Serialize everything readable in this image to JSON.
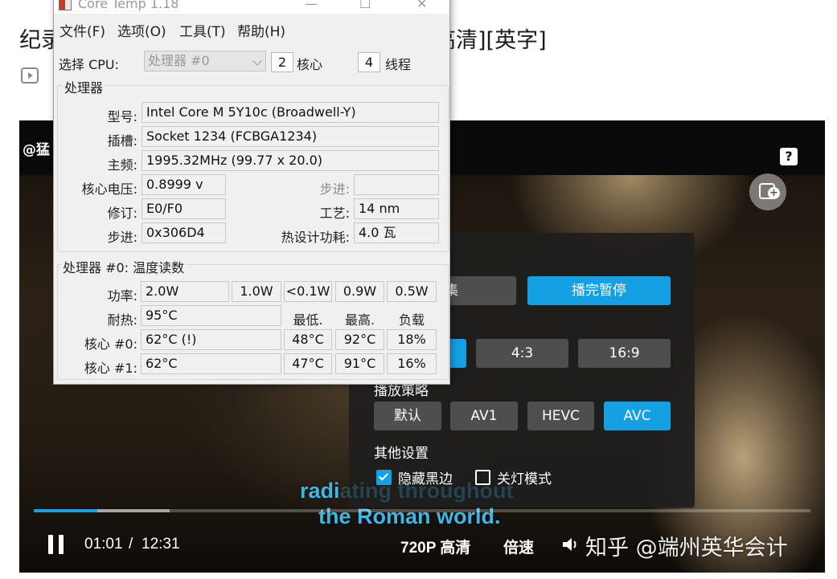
{
  "page": {
    "title_left": "纪录",
    "title_right": "高清][英字]"
  },
  "video": {
    "uploader": "@猛",
    "help_label": "?",
    "settings": {
      "row1": [
        {
          "label": "切集",
          "active": false
        },
        {
          "label": "播完暂停",
          "active": true
        }
      ],
      "row2": [
        {
          "label": "",
          "active": true
        },
        {
          "label": "4:3",
          "active": false
        },
        {
          "label": "16:9",
          "active": false
        }
      ],
      "playback_strategy_label": "播放策略",
      "codecs": [
        {
          "label": "默认",
          "active": false
        },
        {
          "label": "AV1",
          "active": false
        },
        {
          "label": "HEVC",
          "active": false
        },
        {
          "label": "AVC",
          "active": true
        }
      ],
      "other_settings_label": "其他设置",
      "checkboxes": [
        {
          "label": "隐藏黑边",
          "checked": true
        },
        {
          "label": "关灯模式",
          "checked": false
        }
      ]
    },
    "subtitles": {
      "line1_visible": "radi",
      "line1_faded": "ating throughout",
      "line2": "the Roman world."
    },
    "progress": {
      "played": 0.082,
      "buffered": 0.175
    },
    "controls": {
      "current_time": "01:01",
      "separator": "/",
      "duration": "12:31",
      "quality": "720P 高清",
      "speed": "倍速"
    },
    "watermark": "知乎 @端州英华会计"
  },
  "coretemp": {
    "title": "Core Temp 1.18",
    "window_controls": {
      "min": "—",
      "max": "☐",
      "close": "✕"
    },
    "menu": [
      "文件(F)",
      "选项(O)",
      "工具(T)",
      "帮助(H)"
    ],
    "select_cpu_label": "选择 CPU:",
    "cpu_selected": "处理器 #0",
    "cores_value": "2",
    "cores_label": "核心",
    "threads_value": "4",
    "threads_label": "线程",
    "processor_group": "处理器",
    "model_label": "型号:",
    "model_value": "Intel Core M 5Y10c (Broadwell-Y)",
    "socket_label": "插槽:",
    "socket_value": "Socket 1234 (FCBGA1234)",
    "freq_label": "主频:",
    "freq_value": "1995.32MHz (99.77 x 20.0)",
    "vcore_label": "核心电压:",
    "vcore_value": "0.8999 v",
    "stepping_right_label": "步进:",
    "stepping_right_value": "",
    "revision_label": "修订:",
    "revision_value": "E0/F0",
    "lithography_label": "工艺:",
    "lithography_value": "14 nm",
    "cpuid_label": "步进:",
    "cpuid_value": "0x306D4",
    "tdp_label": "热设计功耗:",
    "tdp_value": "4.0 瓦",
    "temp_group": "处理器 #0: 温度读数",
    "power_label": "功率:",
    "power_values": [
      "2.0W",
      "1.0W",
      "<0.1W",
      "0.9W",
      "0.5W"
    ],
    "tjmax_label": "耐热:",
    "tjmax_value": "95°C",
    "headers": [
      "最低.",
      "最高.",
      "负载"
    ],
    "cores": [
      {
        "label": "核心 #0:",
        "temp": "62°C (!)",
        "min": "48°C",
        "max": "92°C",
        "load": "18%"
      },
      {
        "label": "核心 #1:",
        "temp": "62°C",
        "min": "47°C",
        "max": "91°C",
        "load": "16%"
      }
    ]
  }
}
